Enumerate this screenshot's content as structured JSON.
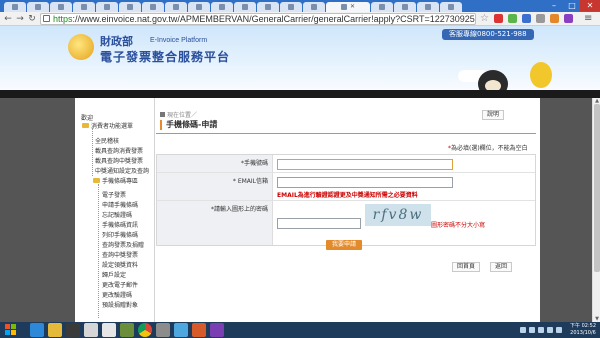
{
  "browser": {
    "url_scheme": "https",
    "url_rest": "://www.einvoice.nat.gov.tw/APMEMBERVAN/GeneralCarrier/generalCarrier!apply?CSRT=1227309254961"
  },
  "header": {
    "logo_text": "財政部",
    "logo_sub": "E-Invoice Platform",
    "title": "電子發票整合服務平台",
    "hotline": "客服專線0800-521-988"
  },
  "sidebar": {
    "welcome": "歡迎",
    "folder_1": "消費者功能選單",
    "items_a": [
      "全民稽核",
      "載具查詢消費發票",
      "載具查詢中獎發票",
      "中獎通知設定及查詢"
    ],
    "folder_2": "手機條碼專區",
    "items_b": [
      "電子發票",
      "申請手機條碼",
      "忘記驗證碼",
      "手機條碼資訊",
      "列印手機條碼",
      "查詢發票及捐贈",
      "查詢中獎發票",
      "設定領獎資料",
      "歸戶設定",
      "更改電子郵件",
      "更改驗證碼",
      "預設捐贈對象"
    ]
  },
  "main": {
    "breadcrumb": "現在位置／",
    "title": "手機條碼-申請",
    "help_label": "說明",
    "req_star": "*",
    "req_note": "為必填(選)欄位，不能為空白",
    "phone_label": "*手機號碼",
    "email_label": "* EMAIL信箱",
    "email_warn": "EMAIL為進行驗證認證更及中獎通知所需之必要資料",
    "captcha_label": "*請輸入圖形上的密碼",
    "captcha_text": "rfv8w",
    "captcha_hint": "圖形密碼不分大小寫",
    "submit_label": "我要申請",
    "home_label": "回首頁",
    "back_label": "返回"
  },
  "taskbar": {
    "clock_time": "下午 02:52",
    "clock_date": "2013/10/6"
  },
  "colors": {
    "accent_orange": "#e38a2a",
    "warning_red": "#cc0000",
    "brand_blue": "#2a4f9c"
  }
}
